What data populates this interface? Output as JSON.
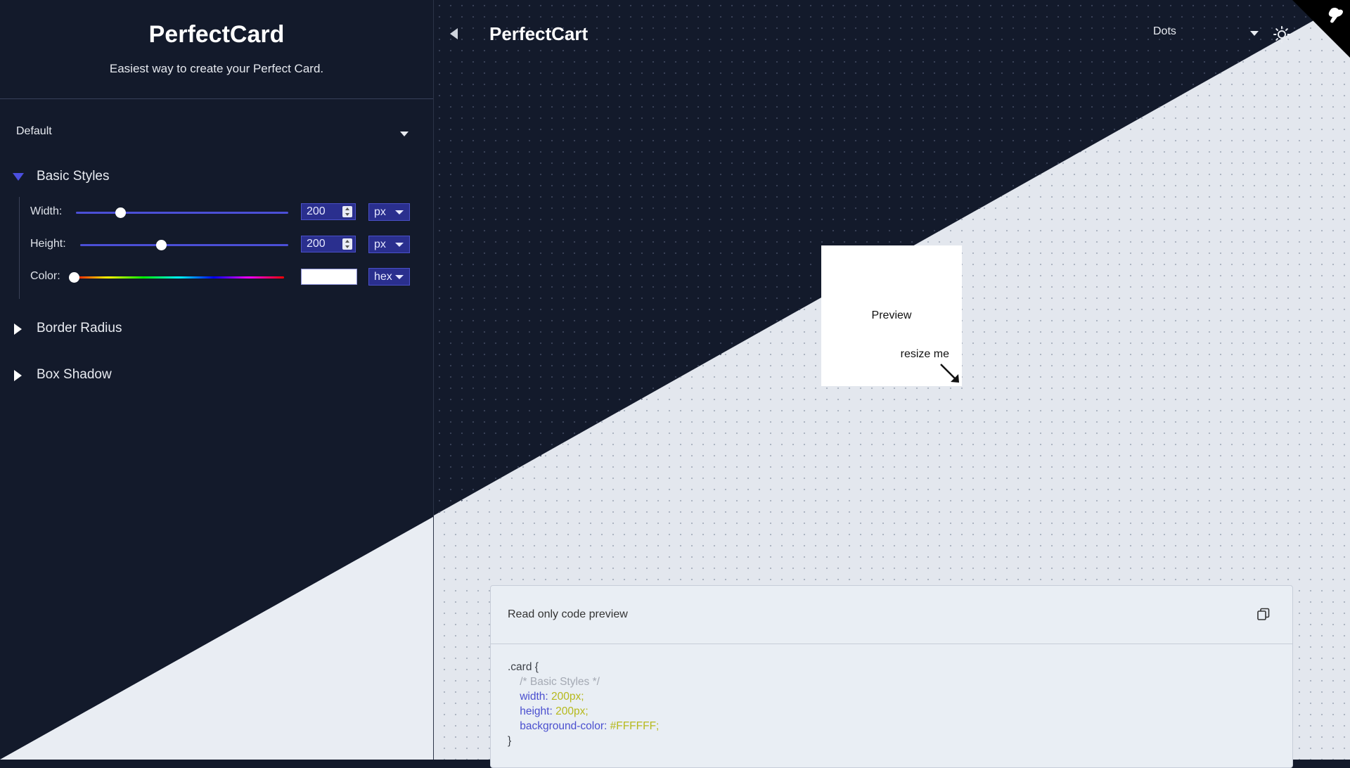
{
  "sidebar": {
    "title": "PerfectCard",
    "subtitle": "Easiest way to create your Perfect Card.",
    "preset": "Default",
    "sections": {
      "basic": {
        "label": "Basic Styles",
        "width": {
          "label": "Width:",
          "value": "200",
          "unit": "px",
          "slider_fraction": 0.2
        },
        "height": {
          "label": "Height:",
          "value": "200",
          "unit": "px",
          "slider_fraction": 0.39
        },
        "color": {
          "label": "Color:",
          "value": "#FFFFFF",
          "unit": "hex",
          "hue_fraction": 0.0
        }
      },
      "border_radius": {
        "label": "Border Radius"
      },
      "box_shadow": {
        "label": "Box Shadow"
      }
    }
  },
  "topbar": {
    "title": "PerfectCart",
    "background_select": "Dots"
  },
  "preview": {
    "label": "Preview",
    "resize_hint": "resize me"
  },
  "code": {
    "header": "Read only code preview",
    "lines": [
      {
        "selector": ".card {"
      },
      {
        "comment": "/* Basic Styles */"
      },
      {
        "prop": "width:",
        "val": " 200px;"
      },
      {
        "prop": "height:",
        "val": " 200px;"
      },
      {
        "prop": "background-color:",
        "val": " #FFFFFF;"
      },
      {
        "close": "}"
      }
    ]
  },
  "colors": {
    "sidebar_bg": "#131a2b",
    "canvas_light": "#e3e7ee",
    "accent": "#4b4fe0",
    "input_bg": "#2a2f8e",
    "code_prop": "#4a4fcf",
    "code_val": "#b6b91c"
  },
  "icons": {
    "back": "chevron-left-icon",
    "theme": "sun-icon",
    "corner": "github-corner-icon",
    "copy": "copy-icon"
  }
}
